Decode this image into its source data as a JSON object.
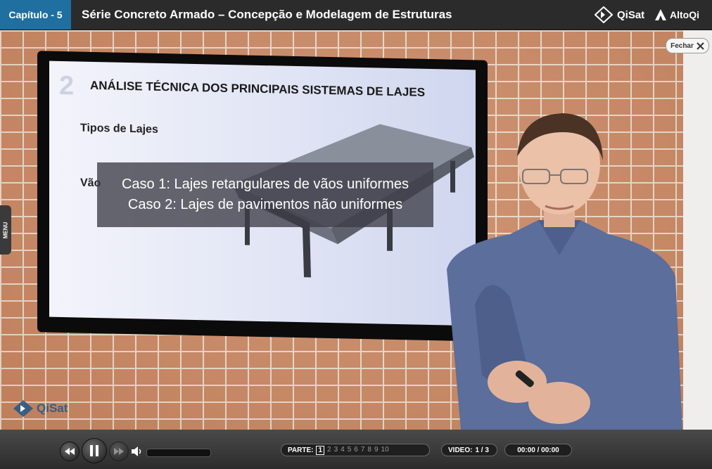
{
  "header": {
    "chapter": "Capítulo - 5",
    "course_title": "Série Concreto Armado – Concepção e Modelagem de Estruturas",
    "logo_qisat": "QiSat",
    "logo_altoqi": "AltoQi"
  },
  "video_area": {
    "close_label": "Fechar",
    "menu_label": "MENU",
    "watermark": "QiSat",
    "slide": {
      "number": "2",
      "title": "ANÁLISE TÉCNICA DOS PRINCIPAIS SISTEMAS DE LAJES",
      "subtitle": "Tipos de Lajes",
      "partial_text": "Vão"
    },
    "caption": {
      "line1": "Caso 1: Lajes retangulares de vãos uniformes",
      "line2": "Caso 2: Lajes de pavimentos não uniformes"
    }
  },
  "controls": {
    "parte_label": "PARTE:",
    "parts": [
      "1",
      "2",
      "3",
      "4",
      "5",
      "6",
      "7",
      "8",
      "9",
      "10"
    ],
    "active_part": "1",
    "video_label": "VIDEO:",
    "video_value": "1 / 3",
    "time": "00:00 / 00:00",
    "volume_level": 0.0
  },
  "colors": {
    "chapter_bg": "#1f6fa0",
    "header_bg": "#2b2b2b",
    "brick": "#c9855f",
    "shirt": "#5b6e9c"
  }
}
